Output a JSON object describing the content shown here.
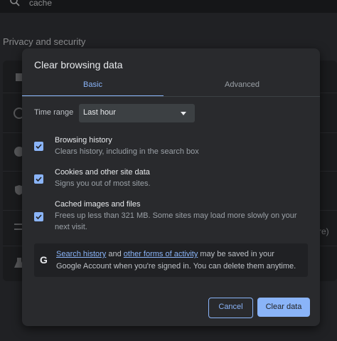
{
  "background": {
    "search_text": "cache",
    "section_title": "Privacy and security",
    "partial_text": "re)"
  },
  "dialog": {
    "title": "Clear browsing data",
    "tabs": [
      {
        "label": "Basic",
        "selected": true
      },
      {
        "label": "Advanced",
        "selected": false
      }
    ],
    "time_range": {
      "label": "Time range",
      "value": "Last hour"
    },
    "options": [
      {
        "title": "Browsing history",
        "description": "Clears history, including in the search box",
        "checked": true
      },
      {
        "title": "Cookies and other site data",
        "description": "Signs you out of most sites.",
        "checked": true
      },
      {
        "title": "Cached images and files",
        "description": "Frees up less than 321 MB. Some sites may load more slowly on your next visit.",
        "checked": true
      }
    ],
    "info": {
      "icon": "google-g-icon",
      "link1": "Search history",
      "text1": " and ",
      "link2": "other forms of activity",
      "text2": " may be saved in your Google Account when you're signed in. You can delete them anytime."
    },
    "buttons": {
      "cancel": "Cancel",
      "clear": "Clear data"
    }
  },
  "colors": {
    "accent": "#8ab4f8",
    "dialog_bg": "#292a2d",
    "page_bg": "#202124"
  }
}
